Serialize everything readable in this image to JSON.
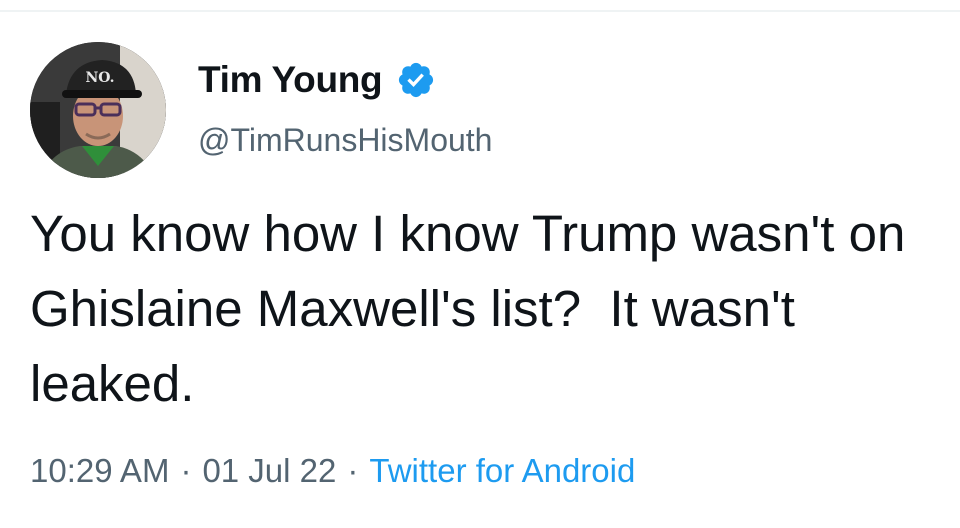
{
  "tweet": {
    "author": {
      "display_name": "Tim Young",
      "handle": "@TimRunsHisMouth",
      "verified": true,
      "hat_text": "NO."
    },
    "text": "You know how I know Trump wasn't on Ghislaine Maxwell's list?  It wasn't leaked.",
    "time": "10:29 AM",
    "separator": "·",
    "date": "01 Jul 22",
    "source": "Twitter for Android"
  },
  "colors": {
    "text_primary": "#0f1419",
    "text_secondary": "#536471",
    "link": "#1d9bf0",
    "verified_badge": "#1d9bf0"
  },
  "icons": {
    "verified": "verified-badge-icon",
    "avatar": "profile-photo"
  }
}
